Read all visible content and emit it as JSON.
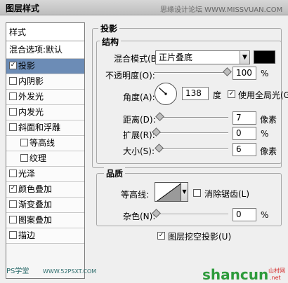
{
  "window": {
    "title": "图层样式",
    "watermark": "思缘设计论坛  WWW.MISSVUAN.COM"
  },
  "styles": {
    "header": "样式",
    "blend_options": "混合选项:默认",
    "items": [
      {
        "label": "投影",
        "checked": true,
        "selected": true
      },
      {
        "label": "内阴影",
        "checked": false
      },
      {
        "label": "外发光",
        "checked": false
      },
      {
        "label": "内发光",
        "checked": false
      },
      {
        "label": "斜面和浮雕",
        "checked": false
      },
      {
        "label": "等高线",
        "checked": false,
        "sub": true
      },
      {
        "label": "纹理",
        "checked": false,
        "sub": true
      },
      {
        "label": "光泽",
        "checked": false
      },
      {
        "label": "颜色叠加",
        "checked": true
      },
      {
        "label": "渐变叠加",
        "checked": false
      },
      {
        "label": "图案叠加",
        "checked": false
      },
      {
        "label": "描边",
        "checked": false
      }
    ],
    "footer_watermark": "PS学堂",
    "footer_url": "WWW.52PSXT.COM"
  },
  "drop_shadow": {
    "section_title": "投影",
    "structure": {
      "title": "结构",
      "blend_mode_label": "混合模式(B):",
      "blend_mode_value": "正片叠底",
      "blend_color": "#000000",
      "opacity_label": "不透明度(O):",
      "opacity_value": "100",
      "opacity_unit": "%",
      "opacity_fraction": 1.0,
      "angle_label": "角度(A):",
      "angle_value": "138",
      "angle_degrees": 138,
      "angle_unit": "度",
      "global_light_label": "使用全局光(G)",
      "global_light_checked": true,
      "distance_label": "距离(D):",
      "distance_value": "7",
      "distance_unit": "像素",
      "distance_fraction": 0.05,
      "spread_label": "扩展(R):",
      "spread_value": "0",
      "spread_unit": "%",
      "spread_fraction": 0.0,
      "size_label": "大小(S):",
      "size_value": "6",
      "size_unit": "像素",
      "size_fraction": 0.04
    },
    "quality": {
      "title": "品质",
      "contour_label": "等高线:",
      "anti_alias_label": "消除锯齿(L)",
      "anti_alias_checked": false,
      "noise_label": "杂色(N):",
      "noise_value": "0",
      "noise_unit": "%",
      "noise_fraction": 0.0
    },
    "knockout_label": "图层挖空投影(U)",
    "knockout_checked": true
  },
  "logo": {
    "text": "shancun",
    "suffix": "山村网",
    "suffix2": ".net"
  }
}
